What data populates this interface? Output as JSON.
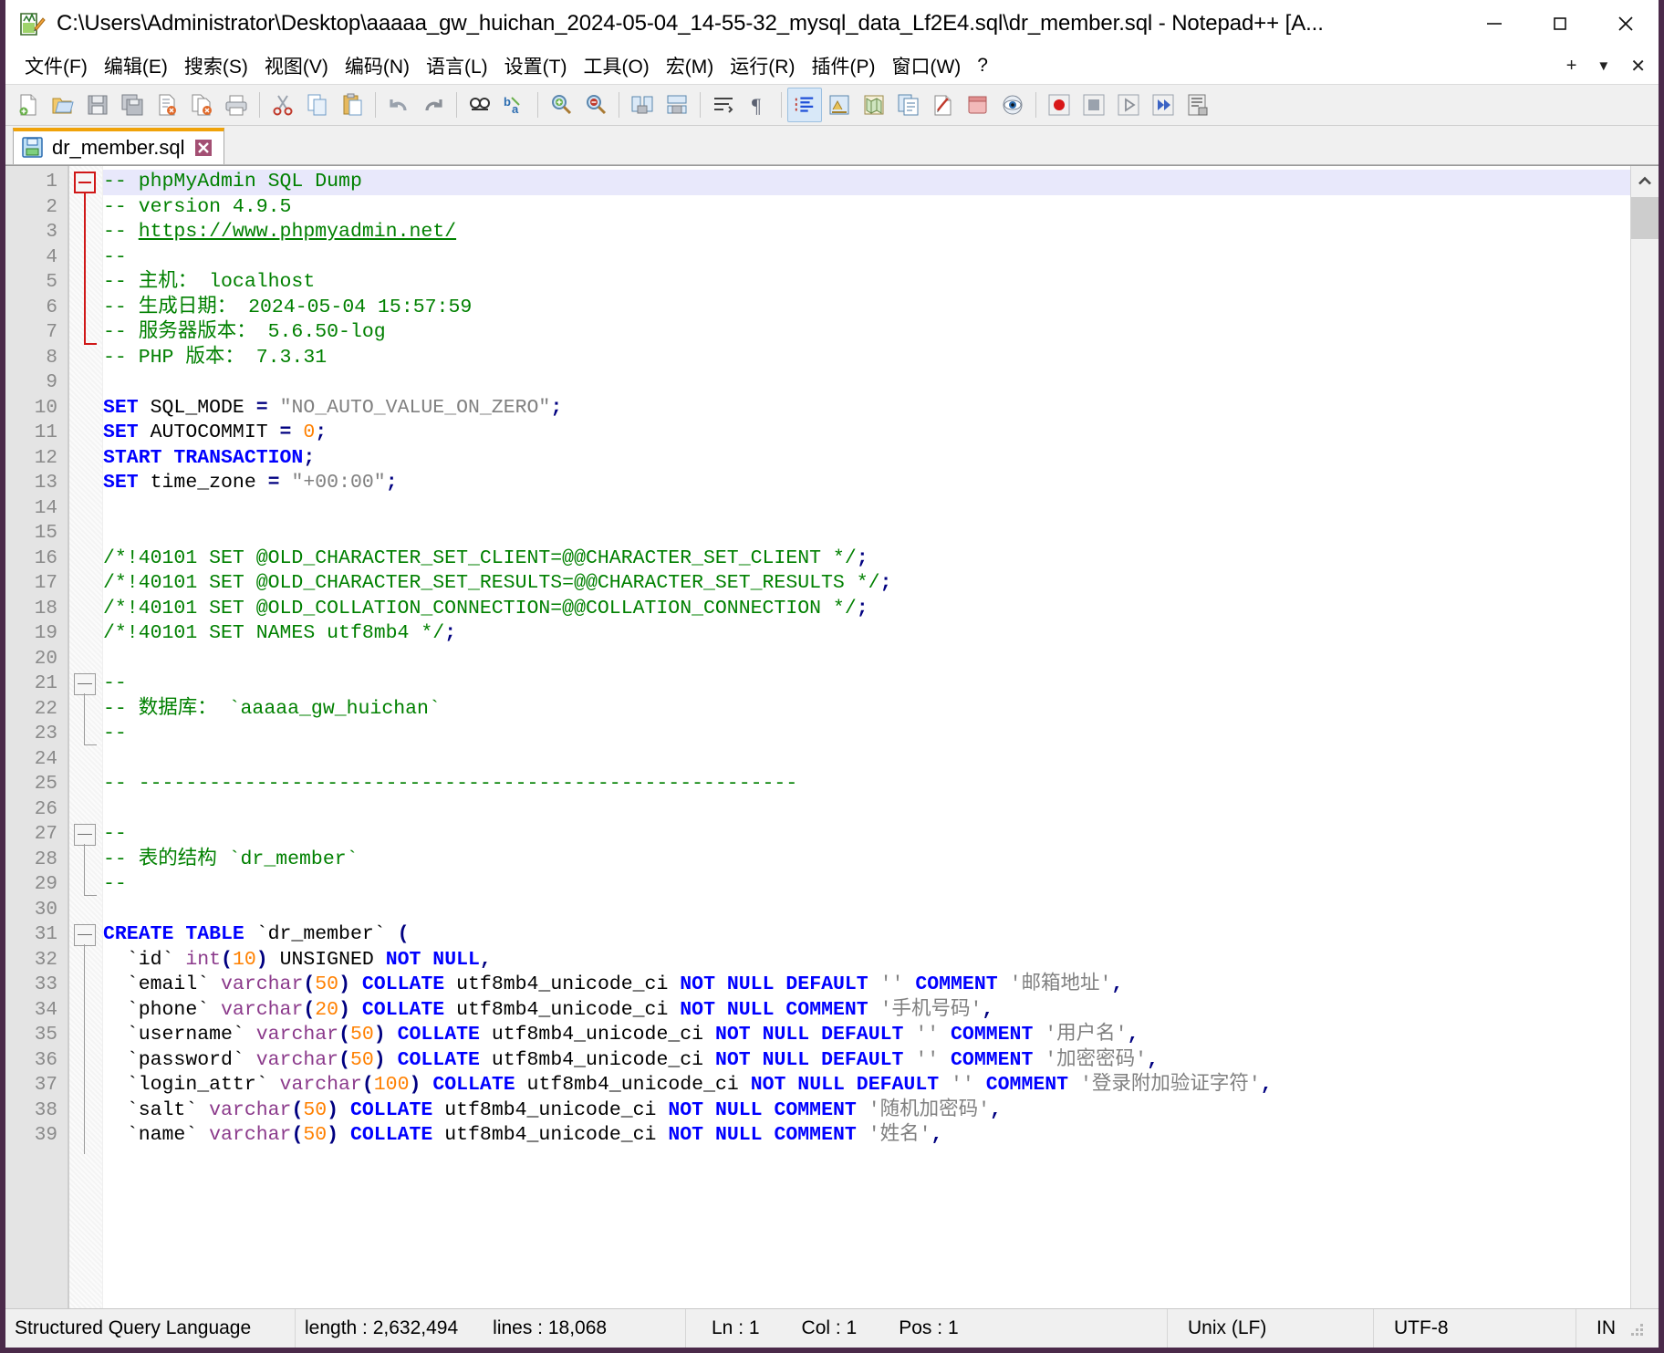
{
  "window": {
    "title": "C:\\Users\\Administrator\\Desktop\\aaaaa_gw_huichan_2024-05-04_14-55-32_mysql_data_Lf2E4.sql\\dr_member.sql - Notepad++ [A...",
    "app_icon": "notepadpp-icon",
    "minimize_label": "–",
    "maximize_label": "☐",
    "close_label": "✕"
  },
  "menu": {
    "items": [
      "文件(F)",
      "编辑(E)",
      "搜索(S)",
      "视图(V)",
      "编码(N)",
      "语言(L)",
      "设置(T)",
      "工具(O)",
      "宏(M)",
      "运行(R)",
      "插件(P)",
      "窗口(W)",
      "?"
    ],
    "right_controls": [
      "+",
      "▼",
      "✕"
    ]
  },
  "toolbar": {
    "groups": [
      [
        "new-file-icon",
        "open-file-icon",
        "save-icon",
        "save-all-icon",
        "close-file-icon",
        "close-all-icon",
        "print-icon"
      ],
      [
        "cut-icon",
        "copy-icon",
        "paste-icon"
      ],
      [
        "undo-icon",
        "redo-icon"
      ],
      [
        "find-icon",
        "replace-icon"
      ],
      [
        "zoom-in-icon",
        "zoom-out-icon"
      ],
      [
        "sync-vertical-icon",
        "sync-horizontal-icon"
      ],
      [
        "word-wrap-icon",
        "show-all-chars-icon"
      ],
      [
        "indent-guide-icon",
        "user-language-icon",
        "doc-map-icon",
        "function-list-icon",
        "folder-as-workspace-icon",
        "doc-switcher-icon",
        "monitoring-icon"
      ],
      [
        "record-macro-icon",
        "stop-macro-icon",
        "play-macro-icon",
        "run-macro-multiple-icon",
        "save-macro-icon"
      ]
    ]
  },
  "tabs": [
    {
      "label": "dr_member.sql",
      "icon": "saved-file-icon",
      "close_icon": "close-tab-icon",
      "active": true
    }
  ],
  "editor": {
    "current_line": 1,
    "lines": [
      {
        "n": 1,
        "tokens": [
          {
            "t": "comment",
            "s": "-- phpMyAdmin SQL Dump"
          }
        ]
      },
      {
        "n": 2,
        "tokens": [
          {
            "t": "comment",
            "s": "-- version 4.9.5"
          }
        ]
      },
      {
        "n": 3,
        "tokens": [
          {
            "t": "comment",
            "s": "-- "
          },
          {
            "t": "link",
            "s": "https://www.phpmyadmin.net/"
          }
        ]
      },
      {
        "n": 4,
        "tokens": [
          {
            "t": "comment",
            "s": "--"
          }
        ]
      },
      {
        "n": 5,
        "tokens": [
          {
            "t": "comment",
            "s": "-- 主机： localhost"
          }
        ]
      },
      {
        "n": 6,
        "tokens": [
          {
            "t": "comment",
            "s": "-- 生成日期： 2024-05-04 15:57:59"
          }
        ]
      },
      {
        "n": 7,
        "tokens": [
          {
            "t": "comment",
            "s": "-- 服务器版本： 5.6.50-log"
          }
        ]
      },
      {
        "n": 8,
        "tokens": [
          {
            "t": "comment",
            "s": "-- PHP 版本： 7.3.31"
          }
        ]
      },
      {
        "n": 9,
        "tokens": []
      },
      {
        "n": 10,
        "tokens": [
          {
            "t": "kw",
            "s": "SET"
          },
          {
            "t": "plain",
            "s": " SQL_MODE "
          },
          {
            "t": "op",
            "s": "="
          },
          {
            "t": "plain",
            "s": " "
          },
          {
            "t": "str",
            "s": "\"NO_AUTO_VALUE_ON_ZERO\""
          },
          {
            "t": "op",
            "s": ";"
          }
        ]
      },
      {
        "n": 11,
        "tokens": [
          {
            "t": "kw",
            "s": "SET"
          },
          {
            "t": "plain",
            "s": " AUTOCOMMIT "
          },
          {
            "t": "op",
            "s": "="
          },
          {
            "t": "plain",
            "s": " "
          },
          {
            "t": "num",
            "s": "0"
          },
          {
            "t": "op",
            "s": ";"
          }
        ]
      },
      {
        "n": 12,
        "tokens": [
          {
            "t": "kw",
            "s": "START TRANSACTION"
          },
          {
            "t": "op",
            "s": ";"
          }
        ]
      },
      {
        "n": 13,
        "tokens": [
          {
            "t": "kw",
            "s": "SET"
          },
          {
            "t": "plain",
            "s": " time_zone "
          },
          {
            "t": "op",
            "s": "="
          },
          {
            "t": "plain",
            "s": " "
          },
          {
            "t": "str",
            "s": "\"+00:00\""
          },
          {
            "t": "op",
            "s": ";"
          }
        ]
      },
      {
        "n": 14,
        "tokens": []
      },
      {
        "n": 15,
        "tokens": []
      },
      {
        "n": 16,
        "tokens": [
          {
            "t": "comment",
            "s": "/*!40101 SET @OLD_CHARACTER_SET_CLIENT=@@CHARACTER_SET_CLIENT */"
          },
          {
            "t": "op",
            "s": ";"
          }
        ]
      },
      {
        "n": 17,
        "tokens": [
          {
            "t": "comment",
            "s": "/*!40101 SET @OLD_CHARACTER_SET_RESULTS=@@CHARACTER_SET_RESULTS */"
          },
          {
            "t": "op",
            "s": ";"
          }
        ]
      },
      {
        "n": 18,
        "tokens": [
          {
            "t": "comment",
            "s": "/*!40101 SET @OLD_COLLATION_CONNECTION=@@COLLATION_CONNECTION */"
          },
          {
            "t": "op",
            "s": ";"
          }
        ]
      },
      {
        "n": 19,
        "tokens": [
          {
            "t": "comment",
            "s": "/*!40101 SET NAMES utf8mb4 */"
          },
          {
            "t": "op",
            "s": ";"
          }
        ]
      },
      {
        "n": 20,
        "tokens": []
      },
      {
        "n": 21,
        "tokens": [
          {
            "t": "comment",
            "s": "--"
          }
        ]
      },
      {
        "n": 22,
        "tokens": [
          {
            "t": "comment",
            "s": "-- 数据库： `aaaaa_gw_huichan`"
          }
        ]
      },
      {
        "n": 23,
        "tokens": [
          {
            "t": "comment",
            "s": "--"
          }
        ]
      },
      {
        "n": 24,
        "tokens": []
      },
      {
        "n": 25,
        "tokens": [
          {
            "t": "comment",
            "s": "-- --------------------------------------------------------"
          }
        ]
      },
      {
        "n": 26,
        "tokens": []
      },
      {
        "n": 27,
        "tokens": [
          {
            "t": "comment",
            "s": "--"
          }
        ]
      },
      {
        "n": 28,
        "tokens": [
          {
            "t": "comment",
            "s": "-- 表的结构 `dr_member`"
          }
        ]
      },
      {
        "n": 29,
        "tokens": [
          {
            "t": "comment",
            "s": "--"
          }
        ]
      },
      {
        "n": 30,
        "tokens": []
      },
      {
        "n": 31,
        "tokens": [
          {
            "t": "kw",
            "s": "CREATE TABLE"
          },
          {
            "t": "plain",
            "s": " `dr_member` "
          },
          {
            "t": "op",
            "s": "("
          }
        ]
      },
      {
        "n": 32,
        "tokens": [
          {
            "t": "plain",
            "s": "  `id` "
          },
          {
            "t": "type",
            "s": "int"
          },
          {
            "t": "op",
            "s": "("
          },
          {
            "t": "num",
            "s": "10"
          },
          {
            "t": "op",
            "s": ")"
          },
          {
            "t": "plain",
            "s": " UNSIGNED "
          },
          {
            "t": "kw",
            "s": "NOT NULL"
          },
          {
            "t": "op",
            "s": ","
          }
        ]
      },
      {
        "n": 33,
        "tokens": [
          {
            "t": "plain",
            "s": "  `email` "
          },
          {
            "t": "type",
            "s": "varchar"
          },
          {
            "t": "op",
            "s": "("
          },
          {
            "t": "num",
            "s": "50"
          },
          {
            "t": "op",
            "s": ")"
          },
          {
            "t": "plain",
            "s": " "
          },
          {
            "t": "kw",
            "s": "COLLATE"
          },
          {
            "t": "plain",
            "s": " utf8mb4_unicode_ci "
          },
          {
            "t": "kw",
            "s": "NOT NULL DEFAULT"
          },
          {
            "t": "plain",
            "s": " "
          },
          {
            "t": "str",
            "s": "''"
          },
          {
            "t": "plain",
            "s": " "
          },
          {
            "t": "kw",
            "s": "COMMENT"
          },
          {
            "t": "plain",
            "s": " "
          },
          {
            "t": "str",
            "s": "'邮箱地址'"
          },
          {
            "t": "op",
            "s": ","
          }
        ]
      },
      {
        "n": 34,
        "tokens": [
          {
            "t": "plain",
            "s": "  `phone` "
          },
          {
            "t": "type",
            "s": "varchar"
          },
          {
            "t": "op",
            "s": "("
          },
          {
            "t": "num",
            "s": "20"
          },
          {
            "t": "op",
            "s": ")"
          },
          {
            "t": "plain",
            "s": " "
          },
          {
            "t": "kw",
            "s": "COLLATE"
          },
          {
            "t": "plain",
            "s": " utf8mb4_unicode_ci "
          },
          {
            "t": "kw",
            "s": "NOT NULL COMMENT"
          },
          {
            "t": "plain",
            "s": " "
          },
          {
            "t": "str",
            "s": "'手机号码'"
          },
          {
            "t": "op",
            "s": ","
          }
        ]
      },
      {
        "n": 35,
        "tokens": [
          {
            "t": "plain",
            "s": "  `username` "
          },
          {
            "t": "type",
            "s": "varchar"
          },
          {
            "t": "op",
            "s": "("
          },
          {
            "t": "num",
            "s": "50"
          },
          {
            "t": "op",
            "s": ")"
          },
          {
            "t": "plain",
            "s": " "
          },
          {
            "t": "kw",
            "s": "COLLATE"
          },
          {
            "t": "plain",
            "s": " utf8mb4_unicode_ci "
          },
          {
            "t": "kw",
            "s": "NOT NULL DEFAULT"
          },
          {
            "t": "plain",
            "s": " "
          },
          {
            "t": "str",
            "s": "''"
          },
          {
            "t": "plain",
            "s": " "
          },
          {
            "t": "kw",
            "s": "COMMENT"
          },
          {
            "t": "plain",
            "s": " "
          },
          {
            "t": "str",
            "s": "'用户名'"
          },
          {
            "t": "op",
            "s": ","
          }
        ]
      },
      {
        "n": 36,
        "tokens": [
          {
            "t": "plain",
            "s": "  `password` "
          },
          {
            "t": "type",
            "s": "varchar"
          },
          {
            "t": "op",
            "s": "("
          },
          {
            "t": "num",
            "s": "50"
          },
          {
            "t": "op",
            "s": ")"
          },
          {
            "t": "plain",
            "s": " "
          },
          {
            "t": "kw",
            "s": "COLLATE"
          },
          {
            "t": "plain",
            "s": " utf8mb4_unicode_ci "
          },
          {
            "t": "kw",
            "s": "NOT NULL DEFAULT"
          },
          {
            "t": "plain",
            "s": " "
          },
          {
            "t": "str",
            "s": "''"
          },
          {
            "t": "plain",
            "s": " "
          },
          {
            "t": "kw",
            "s": "COMMENT"
          },
          {
            "t": "plain",
            "s": " "
          },
          {
            "t": "str",
            "s": "'加密密码'"
          },
          {
            "t": "op",
            "s": ","
          }
        ]
      },
      {
        "n": 37,
        "tokens": [
          {
            "t": "plain",
            "s": "  `login_attr` "
          },
          {
            "t": "type",
            "s": "varchar"
          },
          {
            "t": "op",
            "s": "("
          },
          {
            "t": "num",
            "s": "100"
          },
          {
            "t": "op",
            "s": ")"
          },
          {
            "t": "plain",
            "s": " "
          },
          {
            "t": "kw",
            "s": "COLLATE"
          },
          {
            "t": "plain",
            "s": " utf8mb4_unicode_ci "
          },
          {
            "t": "kw",
            "s": "NOT NULL DEFAULT"
          },
          {
            "t": "plain",
            "s": " "
          },
          {
            "t": "str",
            "s": "''"
          },
          {
            "t": "plain",
            "s": " "
          },
          {
            "t": "kw",
            "s": "COMMENT"
          },
          {
            "t": "plain",
            "s": " "
          },
          {
            "t": "str",
            "s": "'登录附加验证字符'"
          },
          {
            "t": "op",
            "s": ","
          }
        ]
      },
      {
        "n": 38,
        "tokens": [
          {
            "t": "plain",
            "s": "  `salt` "
          },
          {
            "t": "type",
            "s": "varchar"
          },
          {
            "t": "op",
            "s": "("
          },
          {
            "t": "num",
            "s": "50"
          },
          {
            "t": "op",
            "s": ")"
          },
          {
            "t": "plain",
            "s": " "
          },
          {
            "t": "kw",
            "s": "COLLATE"
          },
          {
            "t": "plain",
            "s": " utf8mb4_unicode_ci "
          },
          {
            "t": "kw",
            "s": "NOT NULL COMMENT"
          },
          {
            "t": "plain",
            "s": " "
          },
          {
            "t": "str",
            "s": "'随机加密码'"
          },
          {
            "t": "op",
            "s": ","
          }
        ]
      },
      {
        "n": 39,
        "tokens": [
          {
            "t": "plain",
            "s": "  `name` "
          },
          {
            "t": "type",
            "s": "varchar"
          },
          {
            "t": "op",
            "s": "("
          },
          {
            "t": "num",
            "s": "50"
          },
          {
            "t": "op",
            "s": ")"
          },
          {
            "t": "plain",
            "s": " "
          },
          {
            "t": "kw",
            "s": "COLLATE"
          },
          {
            "t": "plain",
            "s": " utf8mb4_unicode_ci "
          },
          {
            "t": "kw",
            "s": "NOT NULL COMMENT"
          },
          {
            "t": "plain",
            "s": " "
          },
          {
            "t": "str",
            "s": "'姓名'"
          },
          {
            "t": "op",
            "s": ","
          }
        ]
      }
    ]
  },
  "scrollbar": {
    "up_arrow_icon": "chevron-up-icon"
  },
  "statusbar": {
    "language": "Structured Query Language",
    "length": "length : 2,632,494",
    "lines": "lines : 18,068",
    "ln": "Ln : 1",
    "col": "Col : 1",
    "pos": "Pos : 1",
    "eol": "Unix (LF)",
    "encoding": "UTF-8",
    "insert_mode": "IN"
  },
  "colors": {
    "accent_tab": "#f0a30a",
    "comment": "#008000",
    "keyword": "#0000ff",
    "string": "#808080",
    "number": "#ff8000",
    "type": "#8b3a8b",
    "window_border": "#4b2a4a",
    "current_line": "#e8e8fb"
  }
}
